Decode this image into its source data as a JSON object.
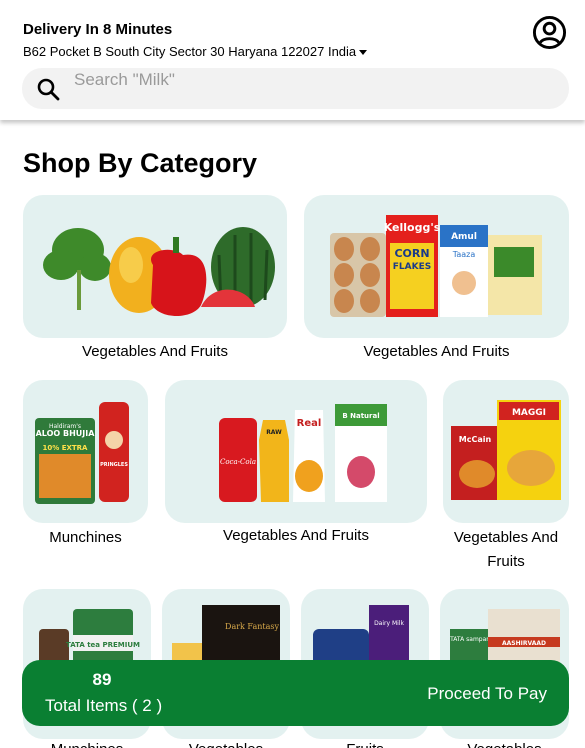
{
  "header": {
    "title": "Delivery In 8 Minutes",
    "address": "B62 Pocket B South City Sector 30 Haryana 122027 India"
  },
  "search": {
    "placeholder": "Search \"Milk\""
  },
  "section_title": "Shop By Category",
  "categories": [
    {
      "label": "Vegetables And Fruits",
      "image": "vegetables-fruits-image"
    },
    {
      "label": "Vegetables And Fruits",
      "image": "dairy-eggs-image"
    },
    {
      "label": "Munchines",
      "image": "snacks-image"
    },
    {
      "label": "Vegetables And Fruits",
      "image": "drinks-juices-image"
    },
    {
      "label": "Vegetables And Fruits",
      "image": "instant-food-image"
    },
    {
      "label": "Munchines",
      "image": "tea-coffee-image"
    },
    {
      "label": "Vegetables",
      "image": "chocolates-image"
    },
    {
      "label": "Fruits",
      "image": "sweets-image"
    },
    {
      "label": "Vegetables",
      "image": "atta-rice-image"
    }
  ],
  "product_text": {
    "kelloggs": "Kellogg's",
    "corn": "CORN",
    "flakes": "FLAKES",
    "amul": "Amul",
    "taaza": "Taaza",
    "haldiram": "Haldiram's",
    "aloo_bhujia": "ALOO BHUJIA",
    "extra": "10% EXTRA",
    "pringles": "PRINGLES",
    "coca_cola": "Coca-Cola",
    "raw": "RAW",
    "real": "Real",
    "b_natural": "B Natural",
    "mccain": "McCain",
    "maggi": "MAGGI",
    "tata_premium": "TATA tea PREMIUM",
    "dark_fantasy": "Dark Fantasy",
    "dairy_milk": "Dairy Milk",
    "tata_sampann": "TATA sampann",
    "aashirvaad": "AASHIRVAAD"
  },
  "footer": {
    "count": "89",
    "items_label": "Total Items ( 2 )",
    "proceed_label": "Proceed To Pay"
  },
  "colors": {
    "accent": "#0a7f32",
    "card_bg": "#e3f1f0",
    "search_bg": "#f2f2f2"
  }
}
